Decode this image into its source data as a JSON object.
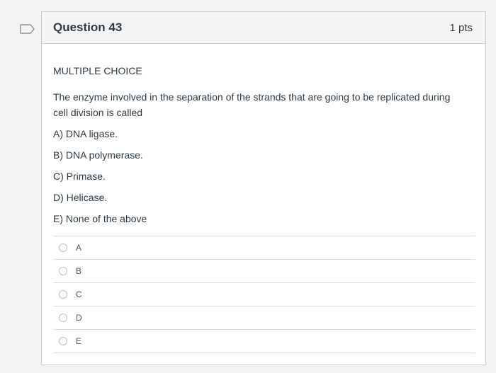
{
  "question": {
    "title": "Question 43",
    "points": "1 pts",
    "kind": "MULTIPLE CHOICE",
    "stem": "The enzyme involved in the separation of the strands that are going to be replicated during cell division is called",
    "choices": [
      "A) DNA ligase.",
      "B) DNA polymerase.",
      "C) Primase.",
      "D) Helicase.",
      "E) None of the above"
    ]
  },
  "answers": [
    "A",
    "B",
    "C",
    "D",
    "E"
  ],
  "icons": {
    "flag": "flag-outline-icon"
  },
  "colors": {
    "border": "#c7cdd1",
    "header_bg": "#f5f5f5",
    "text": "#2d3b45"
  }
}
